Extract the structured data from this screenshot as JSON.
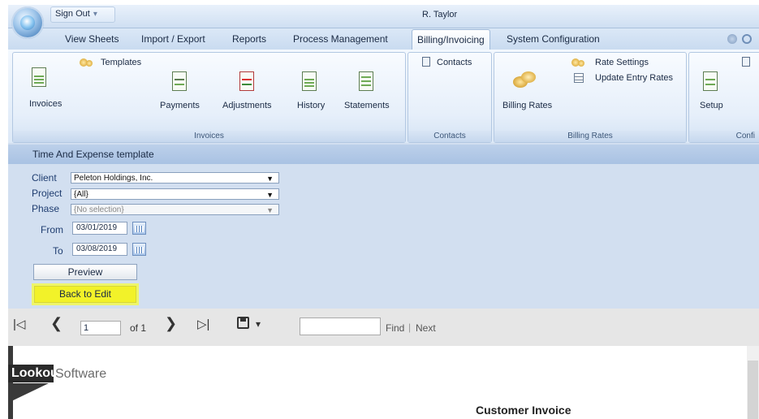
{
  "app": {
    "user": "R. Taylor",
    "sign_out_label": "Sign Out",
    "sign_out_caret": "▾"
  },
  "tabs": [
    {
      "label": "View Sheets",
      "active": false
    },
    {
      "label": "Import / Export",
      "active": false
    },
    {
      "label": "Reports",
      "active": false
    },
    {
      "label": "Process Management",
      "active": false
    },
    {
      "label": "Billing/Invoicing",
      "active": true
    },
    {
      "label": "System Configuration",
      "active": false
    }
  ],
  "ribbon": {
    "invoices_group": {
      "label": "Invoices",
      "templates": "Templates",
      "invoices": "Invoices",
      "payments": "Payments",
      "adjustments": "Adjustments",
      "history": "History",
      "statements": "Statements"
    },
    "contacts_group": {
      "label": "Contacts",
      "contacts": "Contacts"
    },
    "billing_rates_group": {
      "label": "Billing Rates",
      "billing_rates": "Billing Rates",
      "rate_settings": "Rate Settings",
      "update_entry_rates": "Update Entry Rates"
    },
    "config_group": {
      "label": "Confi",
      "setup": "Setup"
    }
  },
  "panel": {
    "title": "Time And Expense template",
    "client_label": "Client",
    "client_value": "Peleton Holdings, Inc.",
    "project_label": "Project",
    "project_value": "{All}",
    "phase_label": "Phase",
    "phase_value": "{No selection}",
    "from_label": "From",
    "from_value": "03/01/2019",
    "to_label": "To",
    "to_value": "03/08/2019",
    "preview_label": "Preview",
    "back_label": "Back to Edit"
  },
  "report_toolbar": {
    "first_glyph": "|◁",
    "prev_glyph": "❮",
    "page_value": "1",
    "of_pages": "of 1",
    "next_glyph": "❯",
    "last_glyph": "▷|",
    "save_glyph": "▾",
    "find_label": "Find",
    "separator": "|",
    "next_label": "Next"
  },
  "report": {
    "logo_bold": "Lookout",
    "logo_light": "Software",
    "heading": "Customer Invoice"
  },
  "colors": {
    "highlight": "#f2f229",
    "panel_bg": "#d2dff0"
  }
}
